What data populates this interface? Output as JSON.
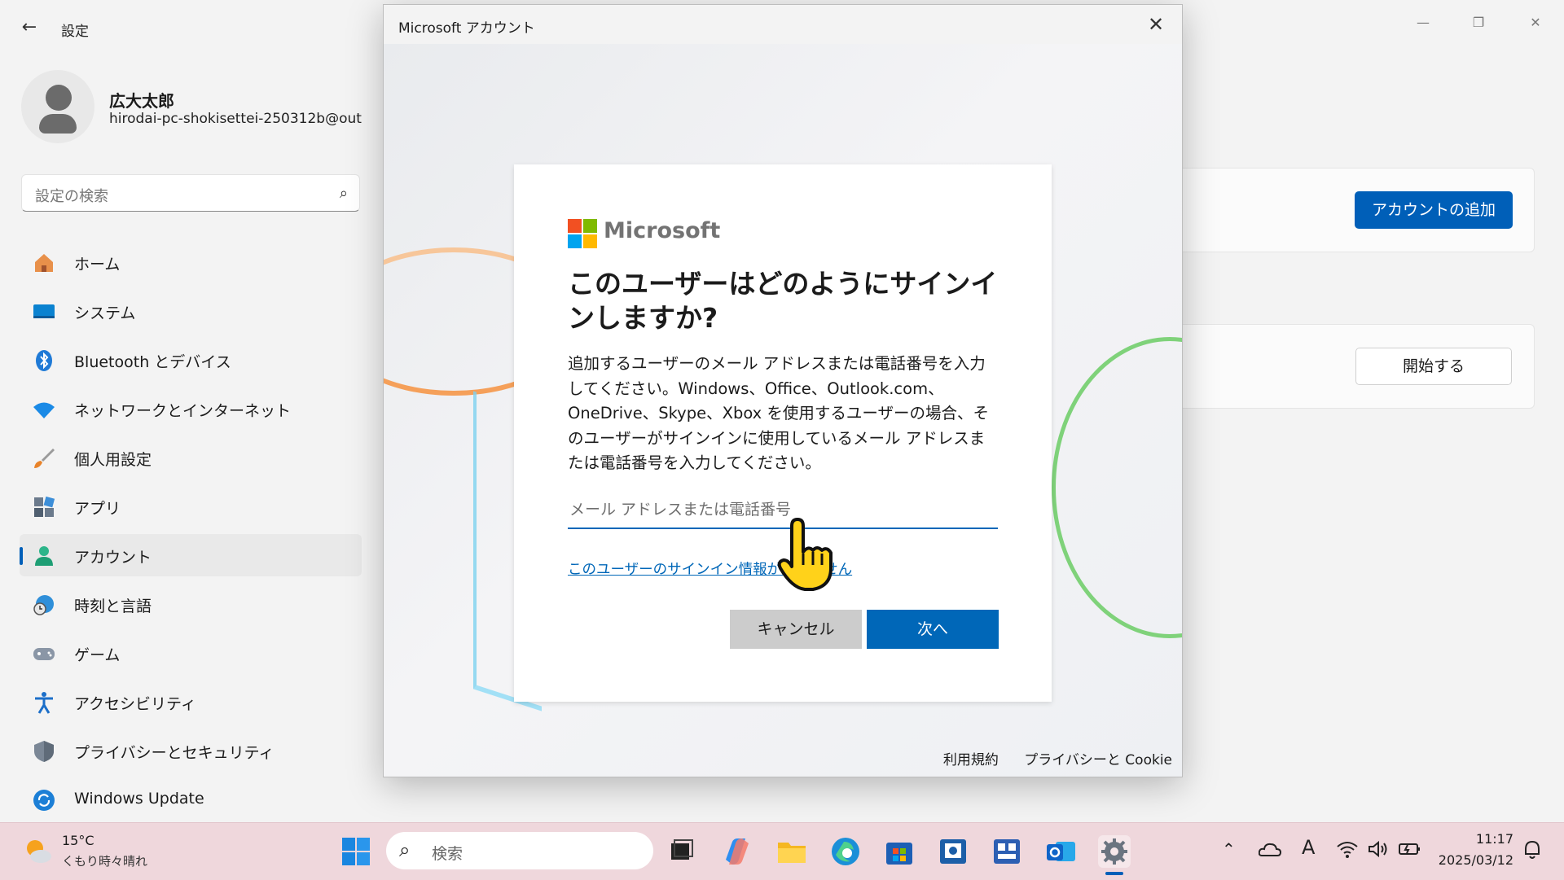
{
  "settings": {
    "title": "設定",
    "back_icon": "←",
    "window_controls": {
      "minimize": "—",
      "maximize": "❐",
      "close": "✕"
    },
    "profile": {
      "name": "広大太郎",
      "email": "hirodai-pc-shokisettei-250312b@out..."
    },
    "search": {
      "placeholder": "設定の検索"
    },
    "nav": [
      {
        "label": "ホーム",
        "icon": "home-icon"
      },
      {
        "label": "システム",
        "icon": "system-icon"
      },
      {
        "label": "Bluetooth とデバイス",
        "icon": "bluetooth-icon"
      },
      {
        "label": "ネットワークとインターネット",
        "icon": "wifi-icon"
      },
      {
        "label": "個人用設定",
        "icon": "brush-icon"
      },
      {
        "label": "アプリ",
        "icon": "apps-icon"
      },
      {
        "label": "アカウント",
        "icon": "account-icon",
        "active": true
      },
      {
        "label": "時刻と言語",
        "icon": "time-language-icon"
      },
      {
        "label": "ゲーム",
        "icon": "gamepad-icon"
      },
      {
        "label": "アクセシビリティ",
        "icon": "accessibility-icon"
      },
      {
        "label": "プライバシーとセキュリティ",
        "icon": "shield-icon"
      },
      {
        "label": "Windows Update",
        "icon": "update-icon"
      }
    ],
    "add_account_button": "アカウントの追加",
    "start_button": "開始する",
    "accent_color": "#005fb8"
  },
  "dialog": {
    "window_title": "Microsoft アカウント",
    "close_glyph": "✕",
    "brand": "Microsoft",
    "heading": "このユーザーはどのようにサインインしますか?",
    "description": "追加するユーザーのメール アドレスまたは電話番号を入力してください。Windows、Office、Outlook.com、OneDrive、Skype、Xbox を使用するユーザーの場合、そのユーザーがサインインに使用しているメール アドレスまたは電話番号を入力してください。",
    "input_value": "",
    "input_placeholder": "メール アドレスまたは電話番号",
    "no_signin_link": "このユーザーのサインイン情報がありません",
    "cancel_button": "キャンセル",
    "next_button": "次へ",
    "footer": {
      "terms": "利用規約",
      "privacy": "プライバシーと Cookie"
    },
    "accent_color": "#0067b8"
  },
  "taskbar": {
    "weather": {
      "temp": "15°C",
      "desc": "くもり時々晴れ"
    },
    "search_placeholder": "検索",
    "pinned_icons": [
      "start-icon",
      "task-view-icon",
      "copilot-icon",
      "file-explorer-icon",
      "edge-icon",
      "store-icon",
      "app-icon",
      "widgets-board-icon",
      "outlook-icon",
      "settings-gear-icon"
    ],
    "tray_icons": [
      "chevron-up-icon",
      "onedrive-icon",
      "ime-icon",
      "wifi-icon",
      "volume-icon",
      "battery-icon",
      "notification-icon"
    ],
    "ime_glyph": "A",
    "time": "11:17",
    "date": "2025/03/12"
  }
}
